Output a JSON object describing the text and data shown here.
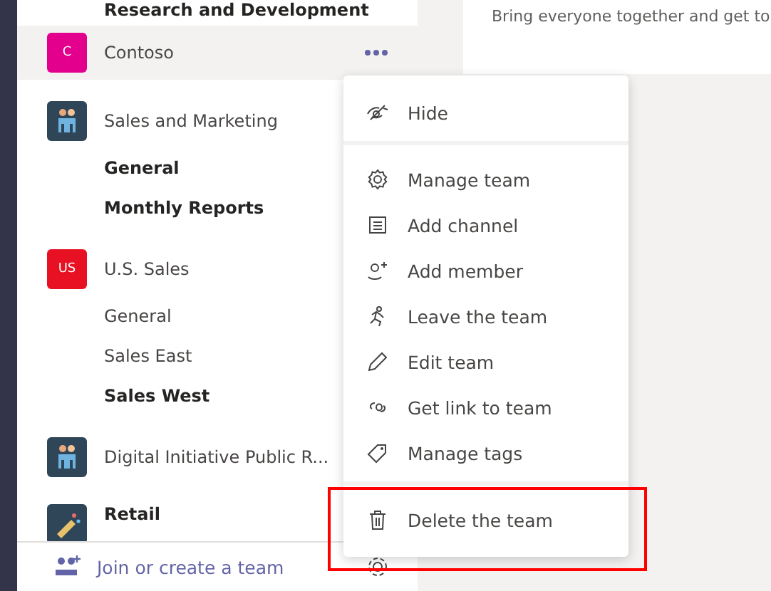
{
  "sidebar": {
    "cut_team": "Research and Development",
    "teams": [
      {
        "name": "Contoso",
        "avatar": {
          "kind": "initials",
          "text": "C",
          "color": "#e3008c"
        },
        "hovered": true,
        "unread": false
      },
      {
        "name": "Sales and Marketing",
        "avatar": {
          "kind": "picture"
        },
        "hovered": false,
        "unread": false,
        "channels": [
          {
            "name": "General",
            "unread": true
          },
          {
            "name": "Monthly Reports",
            "unread": true
          }
        ]
      },
      {
        "name": "U.S. Sales",
        "avatar": {
          "kind": "initials",
          "text": "US",
          "color": "#e81123"
        },
        "hovered": false,
        "unread": false,
        "channels": [
          {
            "name": "General",
            "unread": false
          },
          {
            "name": "Sales East",
            "unread": false
          },
          {
            "name": "Sales West",
            "unread": true
          }
        ]
      },
      {
        "name": "Digital Initiative Public R...",
        "avatar": {
          "kind": "picture"
        },
        "hovered": false,
        "unread": false
      },
      {
        "name": "Retail",
        "avatar": {
          "kind": "picture"
        },
        "hovered": false,
        "unread": true
      }
    ],
    "footer": "Join or create a team"
  },
  "main": {
    "intro": "Bring everyone together and get to"
  },
  "menu": {
    "sections": [
      {
        "items": [
          "Hide"
        ],
        "highlighted": false
      },
      {
        "items": [
          "Manage team",
          "Add channel",
          "Add member",
          "Leave the team",
          "Edit team",
          "Get link to team",
          "Manage tags"
        ],
        "highlighted": false
      },
      {
        "items": [
          "Delete the team"
        ],
        "highlighted": true
      }
    ]
  }
}
